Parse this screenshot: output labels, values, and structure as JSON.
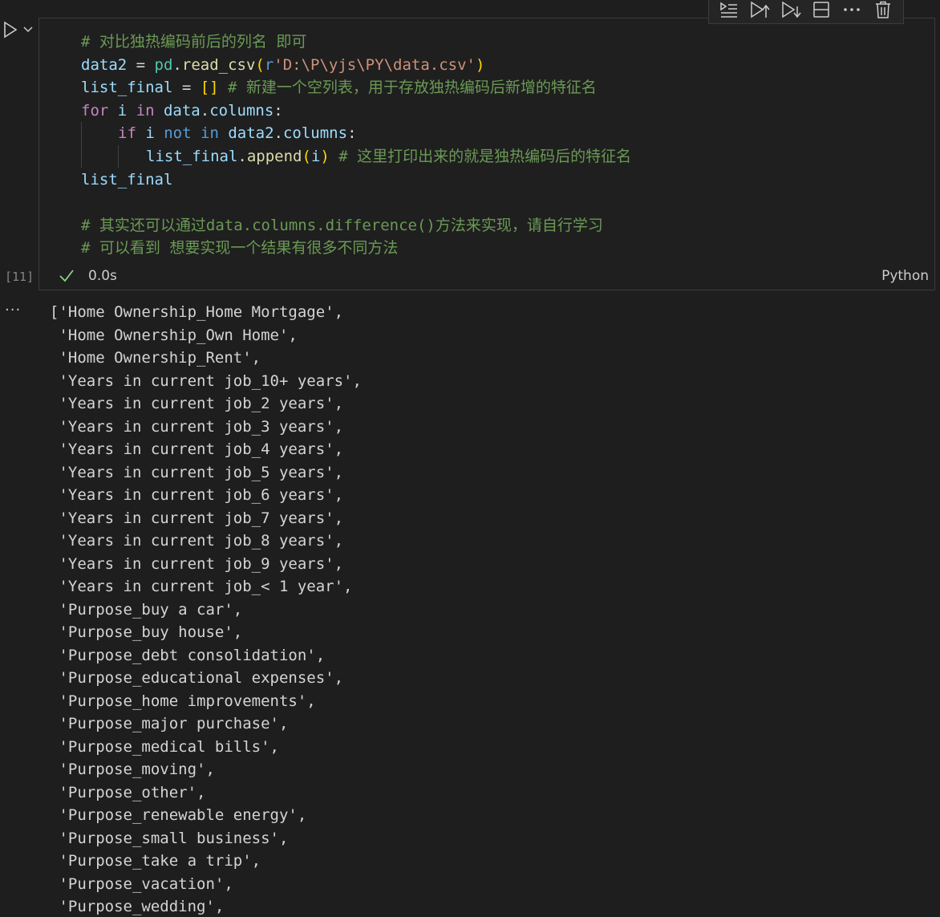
{
  "toolbar": {
    "icons": [
      "execute-above-icon",
      "run-by-line-icon",
      "execute-below-icon",
      "split-cell-icon",
      "more-icon",
      "delete-icon"
    ]
  },
  "cell": {
    "execution_count": "[11]",
    "status_time": "0.0s",
    "language": "Python",
    "code": {
      "l1": "# 对比独热编码前后的列名 即可",
      "l2": {
        "var": "data2",
        "eq": " = ",
        "mod": "pd",
        "dot": ".",
        "fn": "read_csv",
        "po": "(",
        "prefix": "r",
        "str": "'D:\\P\\yjs\\PY\\data.csv'",
        "pc": ")"
      },
      "l3": {
        "var": "list_final",
        "eq": " = ",
        "brk": "[]",
        "com": " # 新建一个空列表，用于存放独热编码后新增的特征名"
      },
      "l4": {
        "kw": "for",
        "v1": " i ",
        "kw2": "in",
        "v2": " data",
        "dot": ".",
        "attr": "columns",
        "colon": ":"
      },
      "l5": {
        "kw": "if",
        "v1": " i ",
        "op": "not",
        "sp": " ",
        "op2": "in",
        "v2": " data2",
        "dot": ".",
        "attr": "columns",
        "colon": ":"
      },
      "l6": {
        "var": "list_final",
        "dot": ".",
        "fn": "append",
        "po": "(",
        "arg": "i",
        "pc": ")",
        "com": " # 这里打印出来的就是独热编码后的特征名"
      },
      "l7": "list_final",
      "l9": "# 其实还可以通过data.columns.difference()方法来实现，请自行学习",
      "l10": "# 可以看到 想要实现一个结果有很多不同方法"
    }
  },
  "output": {
    "more": "···",
    "lines": [
      "['Home Ownership_Home Mortgage',",
      " 'Home Ownership_Own Home',",
      " 'Home Ownership_Rent',",
      " 'Years in current job_10+ years',",
      " 'Years in current job_2 years',",
      " 'Years in current job_3 years',",
      " 'Years in current job_4 years',",
      " 'Years in current job_5 years',",
      " 'Years in current job_6 years',",
      " 'Years in current job_7 years',",
      " 'Years in current job_8 years',",
      " 'Years in current job_9 years',",
      " 'Years in current job_< 1 year',",
      " 'Purpose_buy a car',",
      " 'Purpose_buy house',",
      " 'Purpose_debt consolidation',",
      " 'Purpose_educational expenses',",
      " 'Purpose_home improvements',",
      " 'Purpose_major purchase',",
      " 'Purpose_medical bills',",
      " 'Purpose_moving',",
      " 'Purpose_other',",
      " 'Purpose_renewable energy',",
      " 'Purpose_small business',",
      " 'Purpose_take a trip',",
      " 'Purpose_vacation',",
      " 'Purpose_wedding',"
    ]
  }
}
